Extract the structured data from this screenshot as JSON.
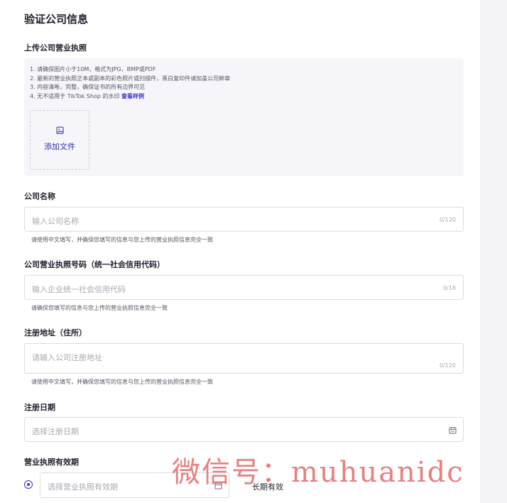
{
  "title": "验证公司信息",
  "upload": {
    "label": "上传公司营业执照",
    "rules": [
      "1. 请确保图片小于10M，格式为JPG，BMP或PDF",
      "2. 最新的营业执照正本或副本的彩色照片或扫描件，黑白复印件请加盖公司鲜章",
      "3. 内容清晰，完整，确保证书的所有边界可见"
    ],
    "rule4_prefix": "4. 无不适用于 TikTok Shop 的水印 ",
    "rule4_link": "查看样例",
    "add_file_label": "添加文件"
  },
  "company_name": {
    "label": "公司名称",
    "placeholder": "输入公司名称",
    "counter": "0/120",
    "helper": "请使用中文填写，并确保您填写的信息与您上传的营业执照信息完全一致"
  },
  "license_number": {
    "label": "公司营业执照号码（统一社会信用代码）",
    "placeholder": "输入企业统一社会信用代码",
    "counter": "0/18",
    "helper": "请确保您填写的信息与您上传的营业执照信息完全一致"
  },
  "address": {
    "label": "注册地址（住所）",
    "placeholder": "请输入公司注册地址",
    "counter": "0/120",
    "helper": "请使用中文填写，并确保您填写的信息与您上传的营业执照信息完全一致"
  },
  "reg_date": {
    "label": "注册日期",
    "placeholder": "选择注册日期"
  },
  "validity": {
    "label": "营业执照有效期",
    "placeholder": "选择营业执照有效期",
    "long_term_label": "长期有效"
  },
  "watermark": "微信号：muhuanidc",
  "colors": {
    "accent": "#3b36c9",
    "page_bg": "#f3f3f7",
    "watermark": "#e88080"
  }
}
